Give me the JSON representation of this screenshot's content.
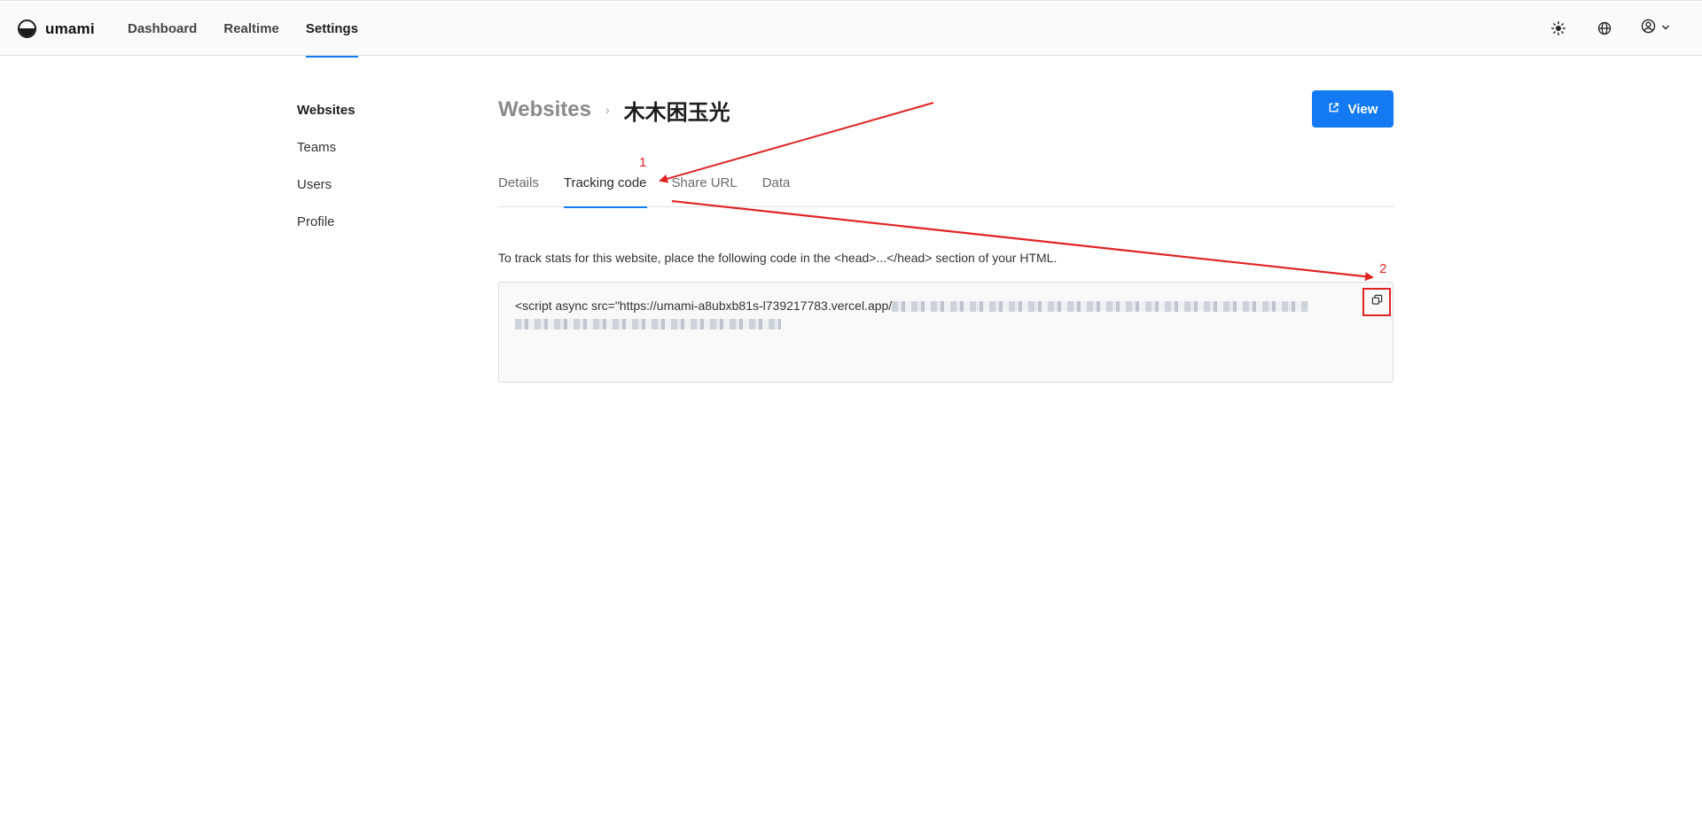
{
  "app": {
    "name": "umami"
  },
  "nav": {
    "items": [
      {
        "label": "Dashboard",
        "active": false
      },
      {
        "label": "Realtime",
        "active": false
      },
      {
        "label": "Settings",
        "active": true
      }
    ]
  },
  "header_icons": {
    "theme": "sun-icon",
    "language": "globe-icon",
    "profile": "user-circle-icon",
    "profile_chevron": "chevron-down-icon"
  },
  "sidebar": {
    "items": [
      {
        "label": "Websites",
        "active": true
      },
      {
        "label": "Teams",
        "active": false
      },
      {
        "label": "Users",
        "active": false
      },
      {
        "label": "Profile",
        "active": false
      }
    ]
  },
  "breadcrumb": {
    "root": "Websites",
    "separator": "›",
    "current": "木木困玉光"
  },
  "view_button": {
    "label": "View",
    "icon": "external-link-icon"
  },
  "tabs": [
    {
      "label": "Details",
      "active": false
    },
    {
      "label": "Tracking code",
      "active": true
    },
    {
      "label": "Share URL",
      "active": false
    },
    {
      "label": "Data",
      "active": false
    }
  ],
  "tracking": {
    "description": "To track stats for this website, place the following code in the <head>...</head> section of your HTML.",
    "code_prefix": "<script async src=\"https://umami-a8ubxb81s-l739217783.vercel.app/"
  },
  "annotations": {
    "label_1": "1",
    "label_2": "2"
  },
  "colors": {
    "accent": "#147af3",
    "annotation": "#e02424"
  }
}
